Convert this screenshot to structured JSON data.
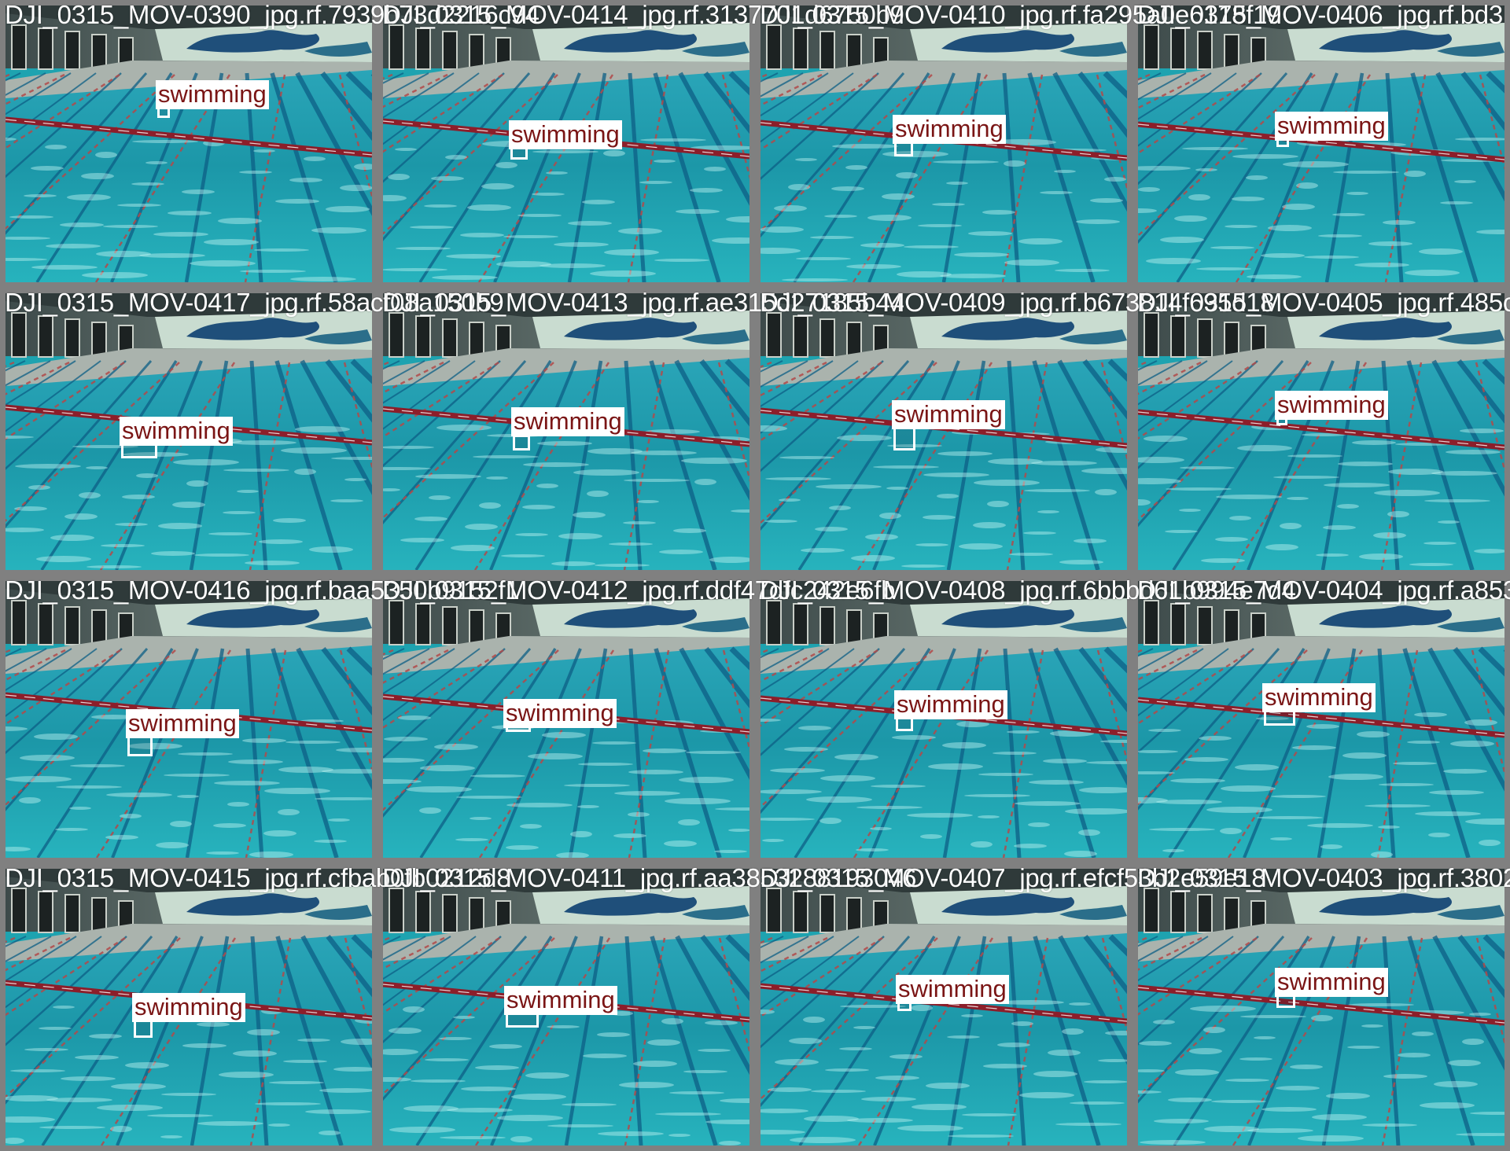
{
  "mosaic": {
    "label_text": "swimming",
    "colors": {
      "background": "#808080",
      "label_text": "#7a1515",
      "label_background": "#ffffff",
      "box_outline": "#ffffff",
      "filename_text": "#ffffff",
      "water": "#1ea3b0"
    },
    "tiles": [
      {
        "filename": "DJI_0315_MOV-0390_jpg.rf.7939b73d2216c94"
      },
      {
        "filename": "DJI_0315_MOV-0414_jpg.rf.3137701d6750b9"
      },
      {
        "filename": "DJI_0315_MOV-0410_jpg.rf.fa295a0e6178f19"
      },
      {
        "filename": "DJI_0315_MOV-0406_jpg.rf.bd3"
      },
      {
        "filename": "DJI_0315_MOV-0417_jpg.rf.58acf08a150b9"
      },
      {
        "filename": "DJI_0315_MOV-0413_jpg.rf.ae315d27185b44"
      },
      {
        "filename": "DJI_0315_MOV-0409_jpg.rf.b673814f695d18"
      },
      {
        "filename": "DJI_0315_MOV-0405_jpg.rf.485c"
      },
      {
        "filename": "DJI_0315_MOV-0416_jpg.rf.baa5350b9152f1"
      },
      {
        "filename": "DJI_0315_MOV-0412_jpg.rf.ddf47dfc242e6fb"
      },
      {
        "filename": "DJI_0315_MOV-0408_jpg.rf.6bbbd61b994e7d4"
      },
      {
        "filename": "DJI_0315_MOV-0404_jpg.rf.a853"
      },
      {
        "filename": "DJI_0315_MOV-0415_jpg.rf.cfbab0fb0212d8"
      },
      {
        "filename": "DJI_0315_MOV-0411_jpg.rf.aa3853288193046"
      },
      {
        "filename": "DJI_0315_MOV-0407_jpg.rf.efcf53b2e59e18"
      },
      {
        "filename": "DJI_0315_MOV-0403_jpg.rf.3802"
      }
    ]
  }
}
